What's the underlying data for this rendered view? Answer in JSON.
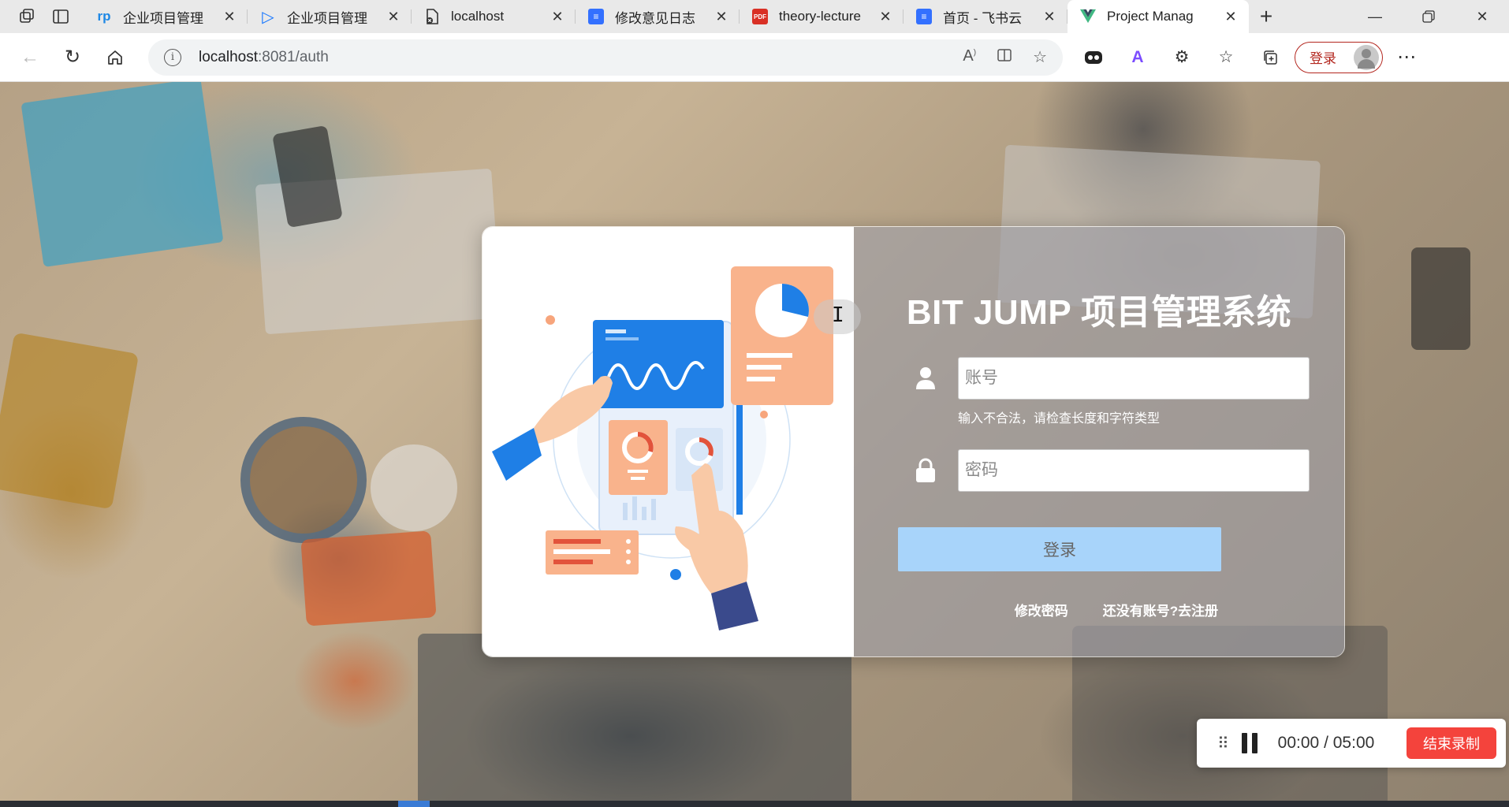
{
  "browser": {
    "tabs": [
      {
        "title": "企业项目管理",
        "icon": "rp-icon",
        "color": "#1e88e5",
        "glyph": "rp"
      },
      {
        "title": "企业项目管理",
        "icon": "play-icon",
        "color": "#1677ff",
        "glyph": "▷"
      },
      {
        "title": "localhost",
        "icon": "broken-page-icon",
        "color": "#333333",
        "glyph": "✕"
      },
      {
        "title": "修改意见日志",
        "icon": "doc-icon",
        "color": "#3370ff",
        "glyph": "≡"
      },
      {
        "title": "theory-lecture",
        "icon": "pdf-icon",
        "color": "#d93025",
        "glyph": "PDF"
      },
      {
        "title": "首页 - 飞书云",
        "icon": "doc-icon",
        "color": "#3370ff",
        "glyph": "≡"
      },
      {
        "title": "Project Manag",
        "icon": "vue-icon",
        "color": "#41b883",
        "glyph": "V",
        "active": true
      }
    ],
    "address": {
      "host": "localhost",
      "path": ":8081/auth"
    },
    "profile_login_label": "登录"
  },
  "login": {
    "title": "BIT JUMP 项目管理系统",
    "account_placeholder": "账号",
    "account_error": "输入不合法，请检查长度和字符类型",
    "password_placeholder": "密码",
    "submit_label": "登录",
    "change_password_link": "修改密码",
    "register_link": "还没有账号?去注册"
  },
  "recorder": {
    "time_elapsed": "00:00",
    "separator": "/",
    "time_limit": "05:00",
    "stop_label": "结束录制"
  },
  "colors": {
    "accent_blue": "#1f7fe6",
    "login_button": "#a8d4fa",
    "stop_button": "#f4433c",
    "illustration_orange": "#f9b38c"
  }
}
